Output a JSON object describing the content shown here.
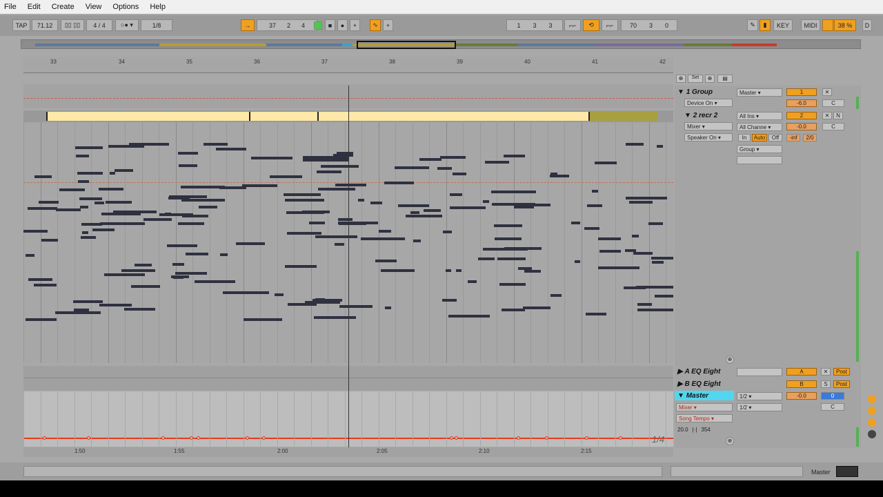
{
  "menu": [
    "File",
    "Edit",
    "Create",
    "View",
    "Options",
    "Help"
  ],
  "toolbar": {
    "tap": "TAP",
    "tempo": "71.12",
    "sig": "4 / 4",
    "quant": "1/8",
    "arrangement_pos": [
      "37",
      "2",
      "4"
    ],
    "loop_start": [
      "1",
      "3",
      "3"
    ],
    "loop_len": [
      "70",
      "3",
      "0"
    ],
    "key": "KEY",
    "midi": "MIDI",
    "cpu": "38 %",
    "d": "D"
  },
  "ruler": [
    "33",
    "34",
    "35",
    "36",
    "37",
    "38",
    "39",
    "40",
    "41",
    "42"
  ],
  "tracks": {
    "group": {
      "name": "1 Group",
      "device": "Device On",
      "output": "Master",
      "num": "1",
      "vol": "-6.0",
      "pan": "C"
    },
    "track2": {
      "name": "2 recr 2",
      "input": "All Ins",
      "channel": "All Channe",
      "mixer": "Mixer",
      "speaker": "Speaker On",
      "output": "Group",
      "num": "2",
      "vol": "-0.0",
      "pan": "C",
      "mon_in": "In",
      "mon_auto": "Auto",
      "mon_off": "Off",
      "send1": "-inf",
      "send2": "2/0"
    },
    "returnA": {
      "name": "A EQ Eight",
      "letter": "A",
      "post": "Post"
    },
    "returnB": {
      "name": "B EQ Eight",
      "letter": "B",
      "s": "S",
      "post": "Post"
    },
    "master": {
      "name": "Master",
      "mixer": "Mixer",
      "param": "Song Tempo",
      "cue": "1/2",
      "out": "1/2",
      "vol": "-0.0",
      "pan": "C",
      "tempo": "20.0",
      "tempo2": "354",
      "num": "0"
    }
  },
  "page_indicator": "1/4",
  "timeline": [
    "1:50",
    "1:55",
    "2:00",
    "2:05",
    "2:10",
    "2:15"
  ],
  "status": {
    "master_label": "Master"
  },
  "colors": {
    "orange": "#f0a020",
    "clip": "#ffe9a8",
    "automation": "#e83a1a",
    "master_header": "#52d6f0",
    "green": "#4ec84e"
  }
}
